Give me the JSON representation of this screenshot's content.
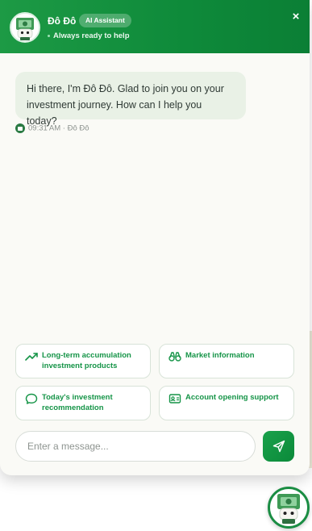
{
  "header": {
    "bot_name": "Đô Đô",
    "badge": "AI Assistant",
    "status": "Always ready to help",
    "close_symbol": "×",
    "avatar_icon": "mascot-avatar-icon"
  },
  "conversation": {
    "message": "Hi there, I'm Đô Đô. Glad to join you on your investment journey. How can I help you today?",
    "meta": "09:31 AM · Đô Đô"
  },
  "suggestions": [
    {
      "label": "Long-term accumulation investment products",
      "icon": "trend-up-icon"
    },
    {
      "label": "Market information",
      "icon": "binoculars-icon"
    },
    {
      "label": "Today's investment recommendation",
      "icon": "chat-bubble-icon"
    },
    {
      "label": "Account opening support",
      "icon": "id-card-icon"
    }
  ],
  "composer": {
    "placeholder": "Enter a message...",
    "value": "",
    "send_icon": "send-icon"
  },
  "colors": {
    "brand_green": "#0e8a3a",
    "suggestion_text": "#159447",
    "bubble_bg": "#e9f1e6"
  }
}
